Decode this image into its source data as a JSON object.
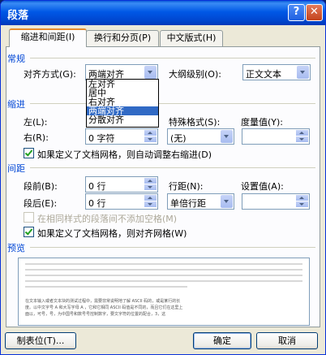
{
  "window": {
    "title": "段落",
    "help": "?",
    "close": "✕"
  },
  "tabs": [
    {
      "label": "缩进和间距(I)",
      "active": true
    },
    {
      "label": "换行和分页(P)",
      "active": false
    },
    {
      "label": "中文版式(H)",
      "active": false
    }
  ],
  "general": {
    "heading": "常规",
    "alignment_label": "对齐方式(G):",
    "alignment_value": "两端对齐",
    "alignment_options": [
      "左对齐",
      "居中",
      "右对齐",
      "两端对齐",
      "分散对齐"
    ],
    "alignment_selected": "两端对齐",
    "outline_label": "大纲级别(O):",
    "outline_value": "正文文本"
  },
  "indent": {
    "heading": "缩进",
    "left_label": "左(L):",
    "right_label": "右(R):",
    "right_value": "0 字符",
    "special_label": "特殊格式(S):",
    "special_value": "(无)",
    "amount_label": "度量值(Y):",
    "amount_value": "",
    "auto_adjust_label": "如果定义了文档网格，则自动调整右缩进(D)",
    "auto_adjust_checked": true
  },
  "spacing": {
    "heading": "间距",
    "before_label": "段前(B):",
    "before_value": "0 行",
    "after_label": "段后(E):",
    "after_value": "0 行",
    "line_label": "行距(N):",
    "line_value": "单倍行距",
    "at_label": "设置值(A):",
    "at_value": "",
    "no_space_label": "在相同样式的段落间不添加空格(M)",
    "no_space_checked": false,
    "snap_grid_label": "如果定义了文档网格，则对齐网格(W)",
    "snap_grid_checked": true
  },
  "preview": {
    "heading": "预览",
    "sample_line1": "在文本输入或者文本块的测试过程中，需要非常说明地了解 ASCII 码的，或是某行的长",
    "sample_line2": "度。以中文字号 A 和大写字母 A ，它和它相同 ASCII 码值是不同的，而且它们在这里上",
    "sample_line3": "面以，可号，号，为中国号和数号号控制数字，要文字符的位置的配合，3，这"
  },
  "buttons": {
    "tabs": "制表位(T)...",
    "ok": "确定",
    "cancel": "取消"
  }
}
